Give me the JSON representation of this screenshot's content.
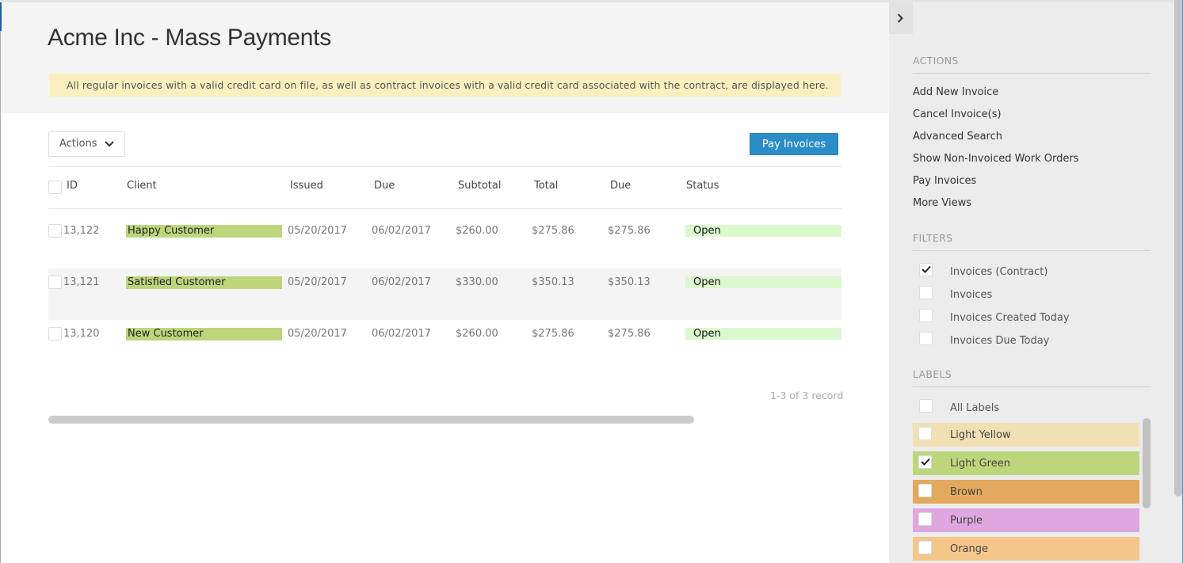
{
  "page": {
    "title": "Acme Inc - Mass Payments",
    "notice": "All regular invoices with a valid credit card on file, as well as contract invoices with a valid credit card associated with the contract, are displayed here."
  },
  "toolbar": {
    "actions_label": "Actions",
    "actions_icon": "chevron-down-icon",
    "pay_button_label": "Pay Invoices"
  },
  "table": {
    "columns": [
      "ID",
      "Client",
      "Issued",
      "Due",
      "Subtotal",
      "Total",
      "Due",
      "Status"
    ],
    "rows": [
      {
        "id": "13,122",
        "client": "Happy Customer",
        "issued": "05/20/2017",
        "due_date": "06/02/2017",
        "subtotal": "$260.00",
        "total": "$275.86",
        "amount_due": "$275.86",
        "status": "Open",
        "selected": false
      },
      {
        "id": "13,121",
        "client": "Satisfied Customer",
        "issued": "05/20/2017",
        "due_date": "06/02/2017",
        "subtotal": "$330.00",
        "total": "$350.13",
        "amount_due": "$350.13",
        "status": "Open",
        "selected": false
      },
      {
        "id": "13,120",
        "client": "New Customer",
        "issued": "05/20/2017",
        "due_date": "06/02/2017",
        "subtotal": "$260.00",
        "total": "$275.86",
        "amount_due": "$275.86",
        "status": "Open",
        "selected": false
      }
    ],
    "client_label_color": "#bdd67c",
    "status_color": "#dbf8cf",
    "pager_text": "1-3 of 3 record"
  },
  "sidebar": {
    "collapse_icon": "chevron-right-icon",
    "actions_heading": "ACTIONS",
    "actions": [
      "Add New Invoice",
      "Cancel Invoice(s)",
      "Advanced Search",
      "Show Non-Invoiced Work Orders",
      "Pay Invoices",
      "More Views"
    ],
    "filters_heading": "FILTERS",
    "filters": [
      {
        "label": "Invoices (Contract)",
        "checked": true
      },
      {
        "label": "Invoices",
        "checked": false
      },
      {
        "label": "Invoices Created Today",
        "checked": false
      },
      {
        "label": "Invoices Due Today",
        "checked": false
      }
    ],
    "labels_heading": "LABELS",
    "all_labels": {
      "label": "All Labels",
      "checked": false
    },
    "labels": [
      {
        "label": "Light Yellow",
        "checked": false,
        "color": "#f2e0b5"
      },
      {
        "label": "Light Green",
        "checked": true,
        "color": "#bdd67c"
      },
      {
        "label": "Brown",
        "checked": false,
        "color": "#e3a95e"
      },
      {
        "label": "Purple",
        "checked": false,
        "color": "#e0a6e0"
      },
      {
        "label": "Orange",
        "checked": false,
        "color": "#f4c68a"
      }
    ]
  },
  "colors": {
    "primary_button": "#2a8dc8",
    "notice_bg": "#faf0bf"
  }
}
